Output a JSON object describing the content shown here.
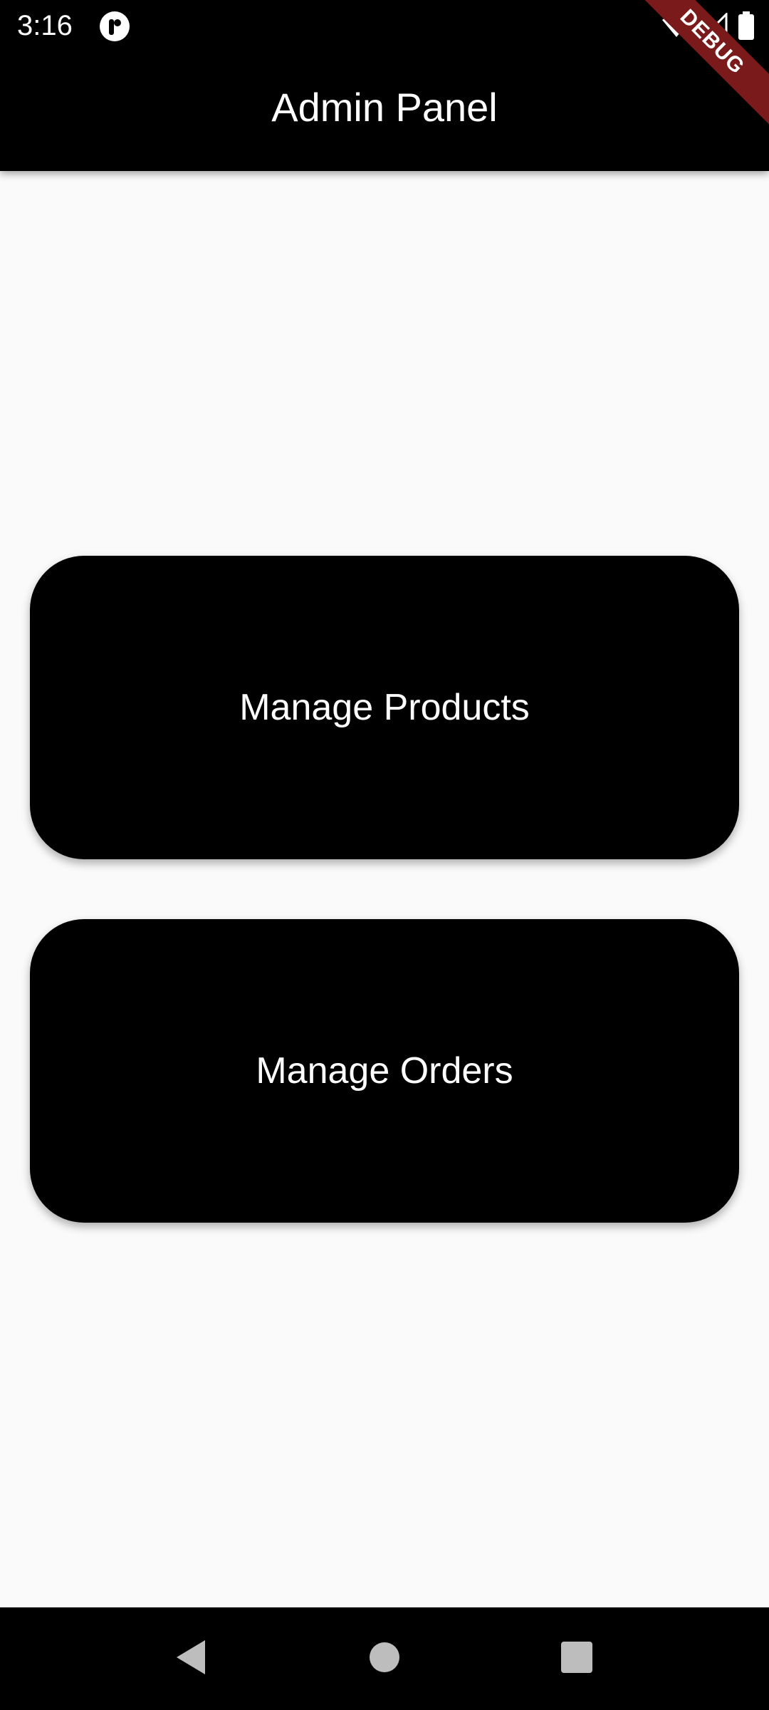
{
  "status_bar": {
    "time": "3:16",
    "app_icon": "app-badge-icon",
    "wifi_icon": "wifi-icon",
    "signal_icon": "signal-icon",
    "battery_icon": "battery-icon"
  },
  "debug_banner": {
    "label": "DEBUG",
    "color": "#7a1a1a"
  },
  "app_bar": {
    "title": "Admin Panel"
  },
  "buttons": [
    {
      "label": "Manage Products"
    },
    {
      "label": "Manage Orders"
    }
  ],
  "nav_bar": {
    "back_icon": "back-triangle-icon",
    "home_icon": "home-circle-icon",
    "recents_icon": "recents-square-icon"
  },
  "colors": {
    "background": "#fafafa",
    "app_bar": "#000000",
    "button": "#000000",
    "button_text": "#ffffff"
  }
}
